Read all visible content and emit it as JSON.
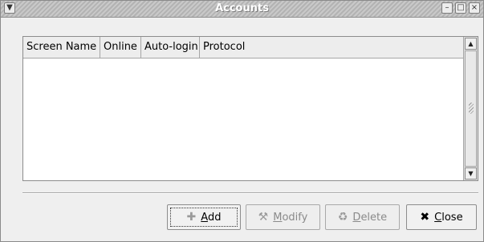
{
  "window": {
    "title": "Accounts",
    "menu_icon": "chevron-down-icon",
    "minimize_icon": "minimize-icon",
    "maximize_icon": "maximize-icon",
    "close_icon": "close-icon"
  },
  "table": {
    "columns": [
      "Screen Name",
      "Online",
      "Auto-login",
      "Protocol"
    ],
    "rows": []
  },
  "buttons": {
    "add": {
      "accesskey": "A",
      "rest": "dd",
      "icon": "add-icon",
      "enabled": true
    },
    "modify": {
      "accesskey": "M",
      "rest": "odify",
      "icon": "modify-icon",
      "enabled": false
    },
    "delete": {
      "accesskey": "D",
      "rest": "elete",
      "icon": "delete-icon",
      "enabled": false
    },
    "close": {
      "accesskey": "C",
      "rest": "lose",
      "icon": "close-icon",
      "enabled": true
    }
  },
  "colors": {
    "window_bg": "#efefef",
    "disabled_text": "#8a8a8a"
  }
}
